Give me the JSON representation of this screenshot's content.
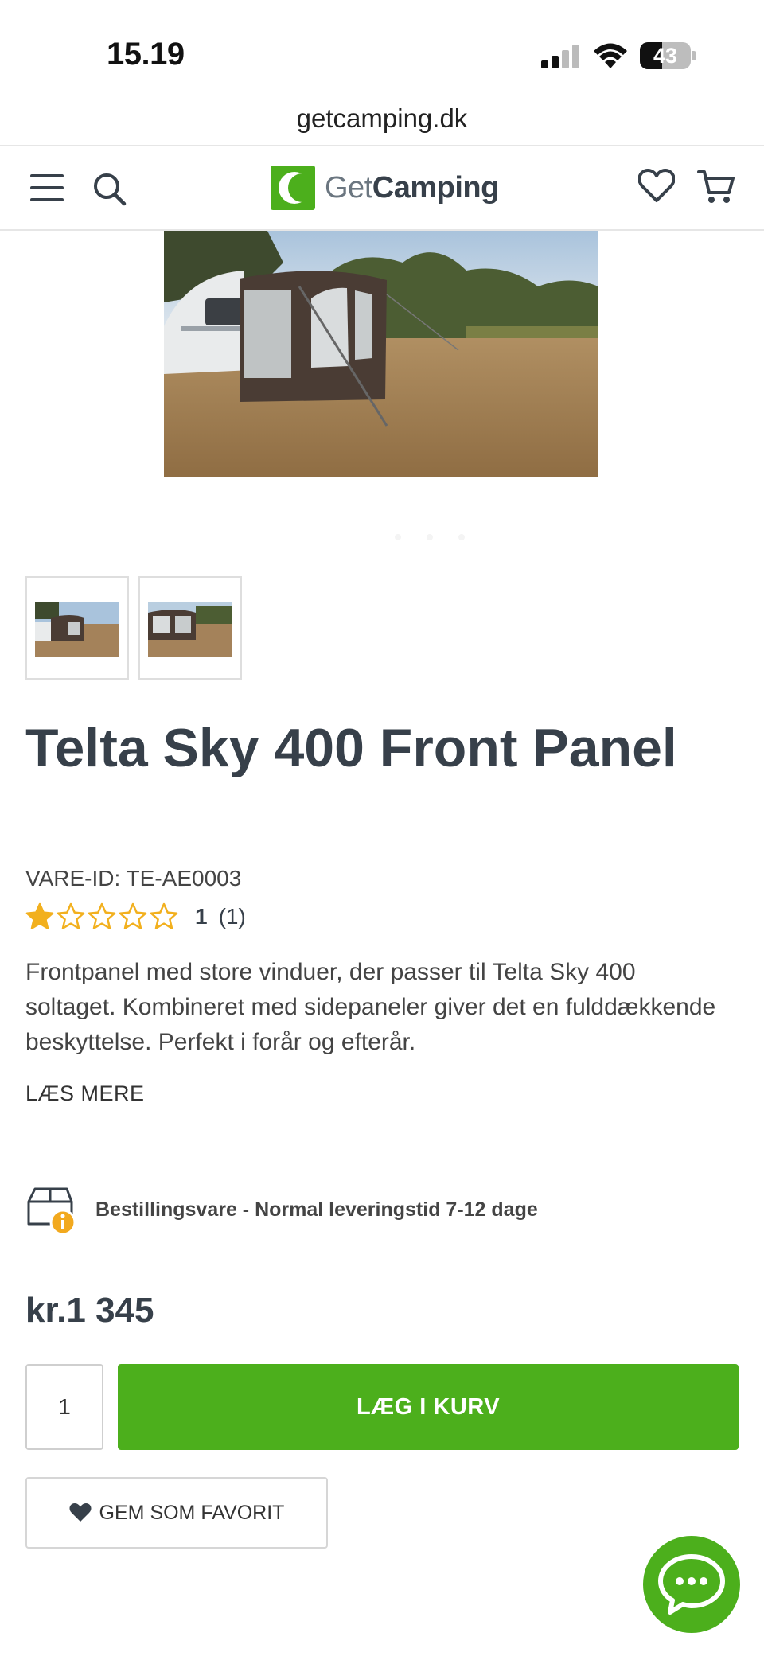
{
  "status_bar": {
    "time": "15.19",
    "battery": "43",
    "battery_level": 0.43
  },
  "browser": {
    "url": "getcamping.dk"
  },
  "header": {
    "logo_prefix": "Get",
    "logo_suffix": "Camping",
    "icons": [
      "menu-icon",
      "search-icon",
      "heart-icon",
      "cart-icon"
    ]
  },
  "product": {
    "title": "Telta Sky 400 Front Panel",
    "sku": "VARE-ID: TE-AE0003",
    "rating_value": "1",
    "rating_count": "(1)",
    "rating_stars_filled": 1,
    "rating_stars_total": 5,
    "description": "Frontpanel med store vinduer, der passer til Telta Sky 400 soltaget. Kombineret med sidepaneler giver det en fulddækkende beskyttelse. Perfekt i forår og efterår.",
    "read_more": "LÆS MERE",
    "delivery": "Bestillingsvare - Normal leveringstid 7-12 dage",
    "price": "kr.1 345",
    "quantity": "1",
    "add_to_cart": "LÆG I KURV",
    "save_favorite": "GEM SOM FAVORIT"
  },
  "colors": {
    "brand_green": "#4caf1c",
    "text_dark": "#37404a",
    "star_gold": "#f2b01e"
  }
}
